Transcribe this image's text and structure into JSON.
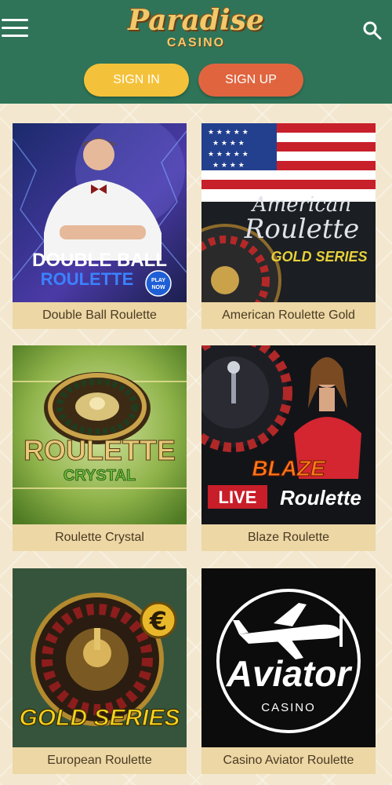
{
  "header": {
    "logo_main": "Paradise",
    "logo_sub": "CASINO",
    "signin_label": "SIGN IN",
    "signup_label": "SIGN UP"
  },
  "colors": {
    "header_bg": "#2f7458",
    "signin_bg": "#f4c23a",
    "signup_bg": "#e0653f",
    "label_bg": "#ecd7a5",
    "page_bg": "#f3e8cf"
  },
  "games": [
    {
      "name": "Double Ball Roulette",
      "art_line1": "DOUBLE BALL",
      "art_line2": "ROULETTE",
      "badge_line1": "PLAY",
      "badge_line2": "NOW"
    },
    {
      "name": "American Roulette Gold",
      "art_line1": "American",
      "art_line2": "Roulette",
      "art_line3": "GOLD SERIES"
    },
    {
      "name": "Roulette Crystal",
      "art_line1": "ROULETTE",
      "art_line2": "CRYSTAL"
    },
    {
      "name": "Blaze Roulette",
      "art_line1": "BLAZE",
      "art_line2": "LIVE",
      "art_line3": "Roulette"
    },
    {
      "name": "European Roulette",
      "art_line1": "GOLD SERIES",
      "art_symbol": "€"
    },
    {
      "name": "Casino Aviator Roulette",
      "art_line1": "Aviator",
      "art_line2": "CASINO"
    }
  ]
}
